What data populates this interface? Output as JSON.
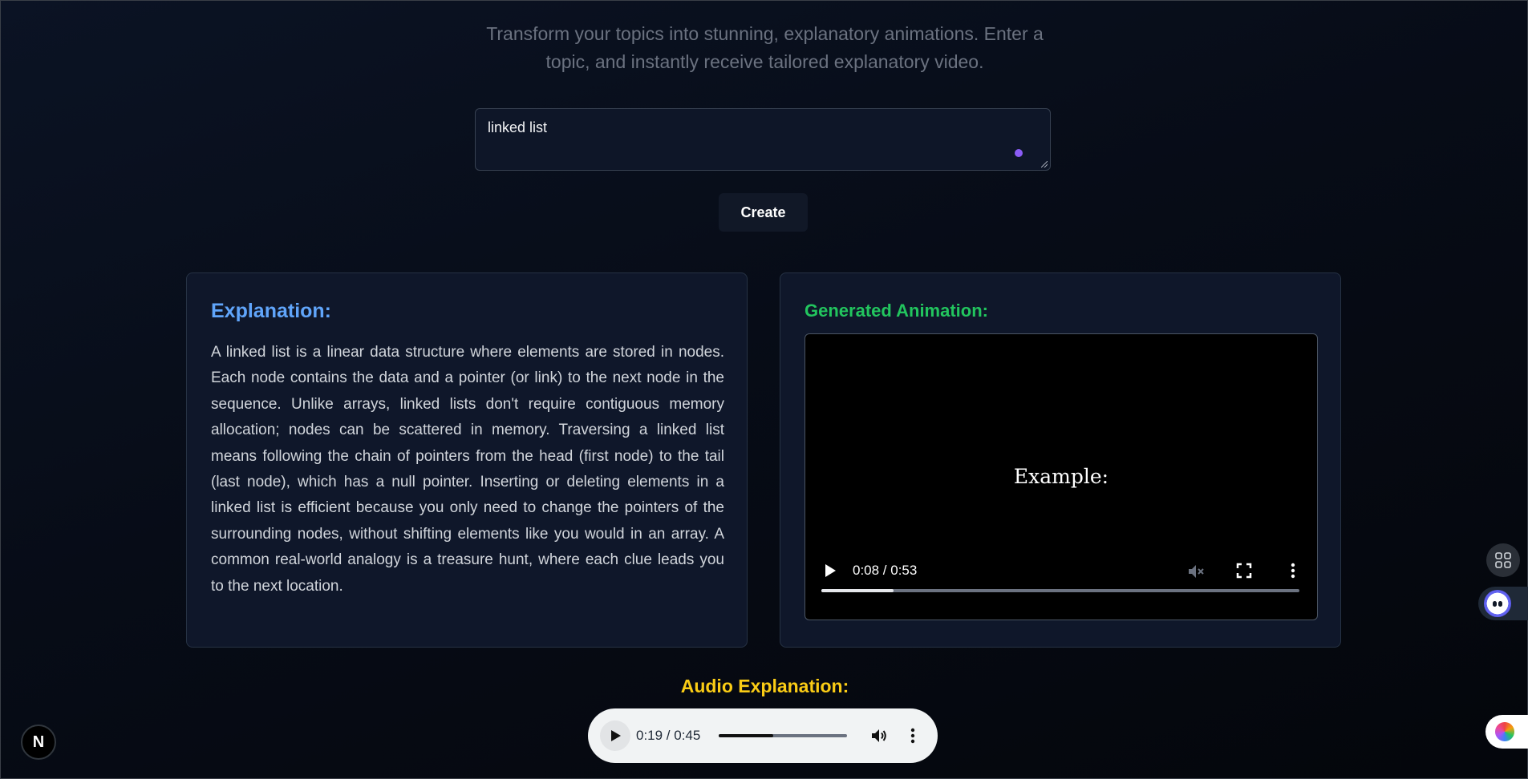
{
  "hero": {
    "tagline_line1": "Transform your topics into stunning, explanatory animations. Enter a",
    "tagline_line2": "topic, and instantly receive tailored explanatory video."
  },
  "topic_input": {
    "value": "linked list"
  },
  "create_button": {
    "label": "Create"
  },
  "explanation": {
    "title": "Explanation:",
    "text": "A linked list is a linear data structure where elements are stored in nodes. Each node contains the data and a pointer (or link) to the next node in the sequence. Unlike arrays, linked lists don't require contiguous memory allocation; nodes can be scattered in memory. Traversing a linked list means following the chain of pointers from the head (first node) to the tail (last node), which has a null pointer. Inserting or deleting elements in a linked list is efficient because you only need to change the pointers of the surrounding nodes, without shifting elements like you would in an array. A common real-world analogy is a treasure hunt, where each clue leads you to the next location."
  },
  "animation": {
    "title": "Generated Animation:",
    "video_caption": "Example:",
    "time": "0:08 / 0:53",
    "progress": 0.151
  },
  "audio": {
    "title": "Audio Explanation:",
    "time": "0:19 / 0:45",
    "progress": 0.422
  },
  "badges": {
    "next_logo": "N"
  },
  "colors": {
    "explanation_title": "#60a5fa",
    "animation_title": "#22c55e",
    "audio_title": "#facc15",
    "input_dot": "#8b5cf6"
  },
  "icons": {
    "video_play": "play-icon",
    "video_mute": "volume-muted-icon",
    "video_fullscreen": "fullscreen-icon",
    "video_more": "more-vertical-icon",
    "audio_play": "play-icon",
    "audio_volume": "volume-icon",
    "audio_more": "more-vertical-icon",
    "side_apps": "apps-grid-icon",
    "side_assistant": "assistant-bot-icon",
    "side_brain": "brain-icon"
  }
}
